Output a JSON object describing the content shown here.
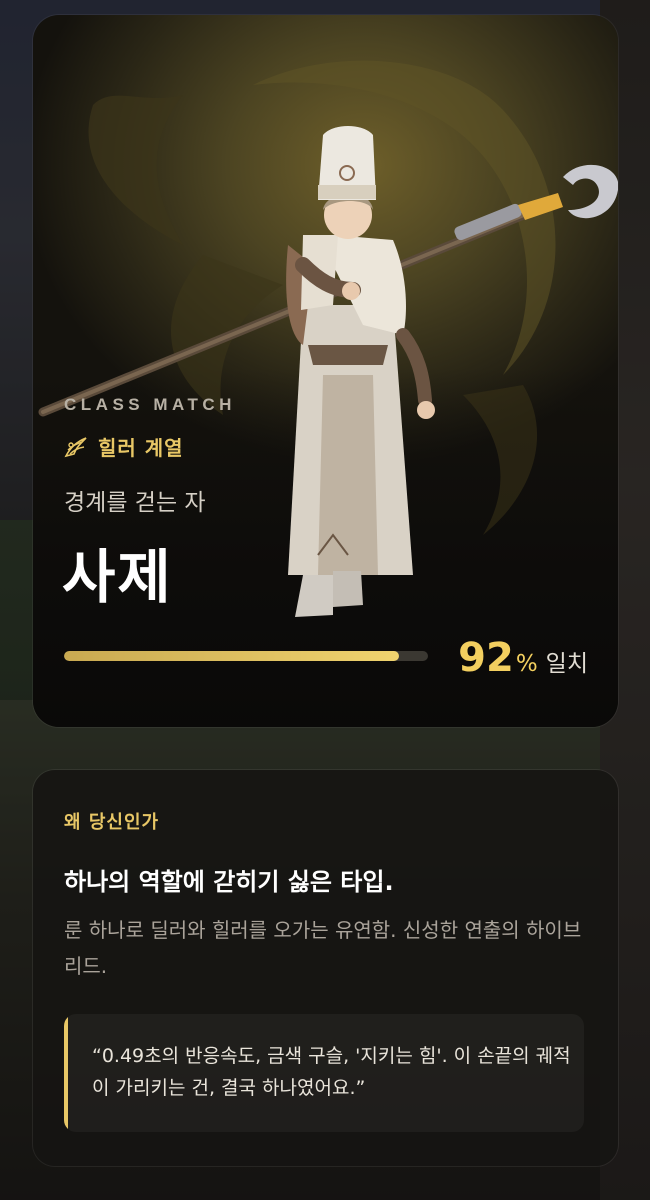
{
  "card": {
    "eyebrow": "CLASS MATCH",
    "lineage_icon": "wing-emblem-icon",
    "lineage_label": "힐러 계열",
    "subtitle": "경계를 걷는 자",
    "class_name": "사제",
    "match": {
      "fraction": 0.92,
      "number": "92",
      "unit": "%",
      "word": "일치"
    }
  },
  "info": {
    "label": "왜 당신인가",
    "headline": "하나의 역할에 갇히기 싫은 타입.",
    "description": "룬 하나로 딜러와 힐러를 오가는 유연함. 신성한 연출의 하이브리드.",
    "quote": "“0.49초의 반응속도, 금색 구슬, '지키는 힘'. 이 손끝의 궤적이 가리키는 건, 결국 하나였어요.”"
  },
  "colors": {
    "accent_gold": "#e8c766",
    "score_gold": "#f3cf5f",
    "card_bg": "#14120d"
  }
}
